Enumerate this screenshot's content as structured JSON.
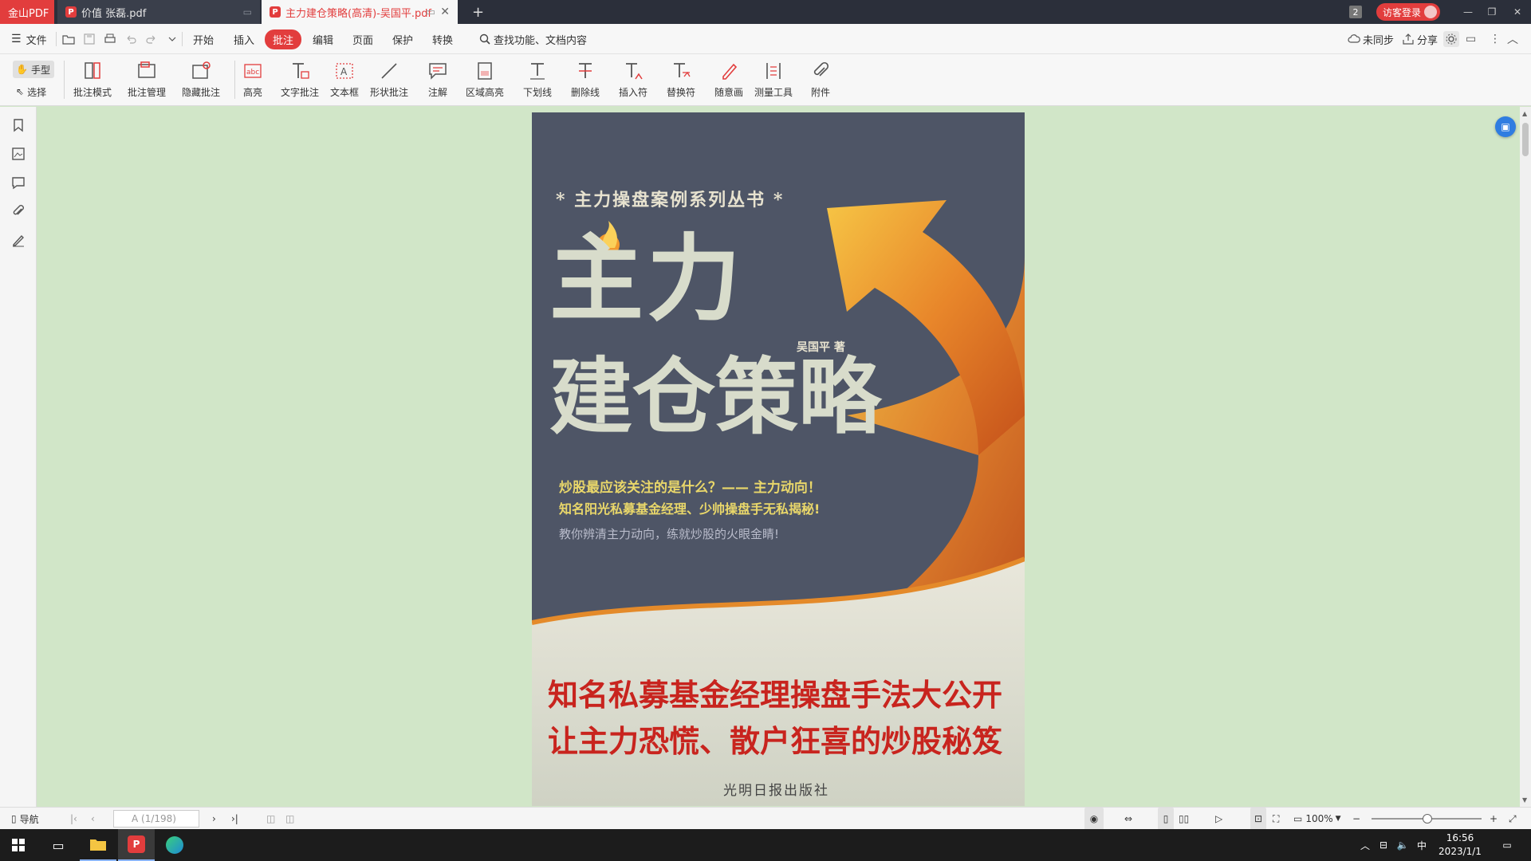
{
  "tabs": {
    "app_label": "金山PDF",
    "tab1_label": "价值 张磊.pdf",
    "tab2_label": "主力建仓策略(高清)-吴国平.pdf",
    "add": "+"
  },
  "window": {
    "badge": "2",
    "login": "访客登录"
  },
  "menu": {
    "file": "文件",
    "tabs": [
      "开始",
      "插入",
      "批注",
      "编辑",
      "页面",
      "保护",
      "转换"
    ],
    "search": "查找功能、文档内容",
    "sync": "未同步",
    "share": "分享"
  },
  "ribbon": {
    "hand": "手型",
    "select": "选择",
    "items": [
      "批注模式",
      "批注管理",
      "隐藏批注",
      "高亮",
      "文字批注",
      "文本框",
      "形状批注",
      "注解",
      "区域高亮",
      "下划线",
      "删除线",
      "插入符",
      "替换符",
      "随意画",
      "测量工具",
      "附件"
    ]
  },
  "book": {
    "series": "* 主力操盘案例系列丛书 *",
    "title1": "主力",
    "title2": "建仓策略",
    "author": "吴国平 著",
    "tag1": "炒股最应该关注的是什么？—— 主力动向！",
    "tag2": "知名阳光私募基金经理、少帅操盘手无私揭秘!",
    "tag3": "教你辨清主力动向，练就炒股的火眼金睛!",
    "slogan1": "知名私募基金经理操盘手法大公开",
    "slogan2": "让主力恐慌、散户狂喜的炒股秘笈",
    "publisher": "光明日报出版社"
  },
  "status": {
    "nav": "导航",
    "page_input": "A (1/198)",
    "zoom": "100%"
  },
  "taskbar": {
    "ime": "中",
    "time": "16:56",
    "date": "2023/1/1"
  },
  "colors": {
    "accent": "#e23d3d",
    "canvas_bg": "#d1e6c8",
    "cover_bg": "#4e5566",
    "slogan": "#c8241e"
  }
}
